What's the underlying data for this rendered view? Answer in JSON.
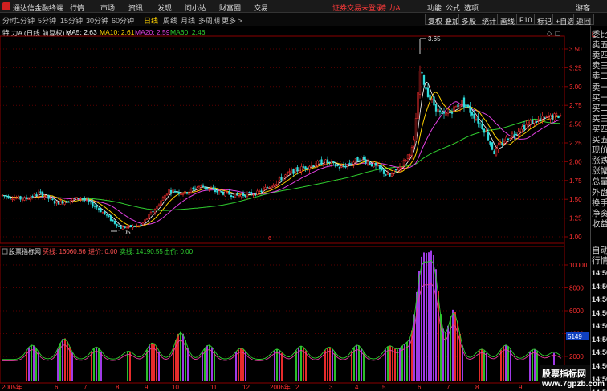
{
  "titlebar": {
    "app_title": "通达信金融终端",
    "menus": [
      "行情",
      "市场",
      "资讯",
      "发现",
      "问小达",
      "财富圈",
      "交易"
    ],
    "login_status": "证券交易未登录",
    "stock_name": "特 力A",
    "right_menus": [
      "功能",
      "公式",
      "选项",
      "游客"
    ]
  },
  "toolbar": {
    "periods": [
      "分时",
      "1分钟",
      "5分钟",
      "15分钟",
      "30分钟",
      "60分钟",
      "日线",
      "周线",
      "月线",
      "多周期",
      "更多 >"
    ],
    "active_period": "日线",
    "buttons": [
      "复权",
      "叠加",
      "多股",
      "统计",
      "画线",
      "F10",
      "标记",
      "+自选",
      "返回"
    ]
  },
  "info": {
    "stock_label": "特 力A (日线 前复权) ◇",
    "ma5": "MA5: 2.63",
    "ma10": "MA10: 2.61",
    "ma20": "MA20: 2.59",
    "ma60": "MA60: 2.46"
  },
  "colors": {
    "ma5": "#ffffff",
    "ma10": "#ffd200",
    "ma20": "#e040e0",
    "ma60": "#30d030",
    "up": "#ff3030",
    "down": "#30e0e0",
    "axis": "#8b0000",
    "sub_label": "#ff3030",
    "sub_green": "#30d030",
    "sub_purple": "#b040ff"
  },
  "main_chart": {
    "y_ticks": [
      "3.50",
      "3.25",
      "3.00",
      "2.75",
      "2.50",
      "2.25",
      "2.00",
      "1.75",
      "1.50",
      "1.25",
      "1.00"
    ],
    "high_label": "3.65",
    "low_label": "1.05",
    "marker": "6"
  },
  "sub_chart": {
    "title": "股票指标网",
    "buy_line": "买线: 16060.86",
    "entry_price": "进价: 0.00",
    "sell_line": "卖线: 14190.55",
    "exit_price": "出价: 0.00",
    "y_ticks": [
      "10000",
      "8000",
      "6000",
      "4000",
      "2000"
    ],
    "current_value": "5149"
  },
  "time_axis": {
    "labels": [
      "2005年",
      "6",
      "7",
      "8",
      "9",
      "10",
      "11",
      "12",
      "2006年",
      "2",
      "3",
      "4",
      "5",
      "6",
      "7",
      "8",
      "9"
    ]
  },
  "right_panel": {
    "rows": [
      "委比",
      "卖五",
      "卖四",
      "卖三",
      "卖二",
      "卖一",
      "买一",
      "买二",
      "买三",
      "买四",
      "买五",
      "现价",
      "涨跌",
      "涨幅",
      "总量",
      "外盘",
      "换手",
      "净资",
      "收益"
    ],
    "times_header": [
      "自动",
      "行情"
    ],
    "times": [
      "14:50",
      "14:50",
      "14:50",
      "14:50",
      "14:50",
      "14:50",
      "14:50",
      "14:50",
      "14:50",
      "14:50"
    ]
  },
  "watermark": {
    "line1": "股票指标网",
    "line2": "www.7gpzb.com"
  }
}
